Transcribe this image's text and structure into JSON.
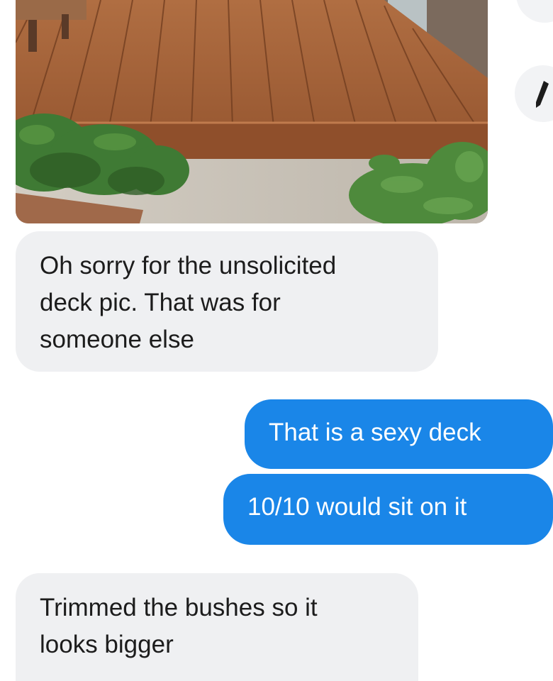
{
  "photo": {
    "subject": "wooden deck with bushes",
    "colors": {
      "deck": "#a8643a",
      "plank_seam": "#6e3b1e",
      "foliage": "#3f7a34",
      "pavement": "#c9c3b9"
    }
  },
  "side_actions": [
    {
      "icon": "circle-button"
    },
    {
      "icon": "pencil-icon"
    }
  ],
  "messages": [
    {
      "sender": "them",
      "lines": [
        "Oh sorry for the unsolicited",
        "deck pic. That was for",
        "someone else"
      ]
    },
    {
      "sender": "me",
      "text": "That is a sexy deck"
    },
    {
      "sender": "me",
      "text": "10/10 would sit on it"
    },
    {
      "sender": "them",
      "lines": [
        "Trimmed the bushes so it",
        "looks bigger"
      ]
    }
  ],
  "colors": {
    "incoming_bubble": "#eff0f2",
    "outgoing_bubble": "#1a86e8",
    "incoming_text": "#1c1c1c",
    "outgoing_text": "#ffffff"
  }
}
